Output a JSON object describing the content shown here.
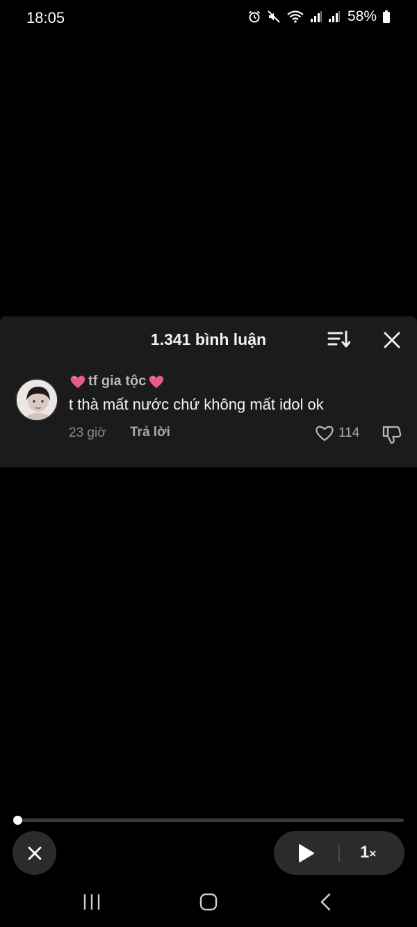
{
  "status_bar": {
    "time": "18:05",
    "battery": "58%",
    "icons": [
      "alarm-icon",
      "mute-icon",
      "wifi-icon",
      "signal-icon",
      "signal-icon",
      "battery-icon"
    ]
  },
  "comments_panel": {
    "title": "1.341 bình luận",
    "sort_icon": "sort-icon",
    "close_icon": "close-icon",
    "comment": {
      "username": "tf gia tộc",
      "username_decoration": "pink-heart-emoji",
      "text": "t thà mất nước chứ không mất idol ok",
      "time": "23 giờ",
      "reply_label": "Trả lời",
      "like_count": "114"
    }
  },
  "player": {
    "progress_fraction": 0.0,
    "speed_value": "1",
    "speed_suffix": "×"
  },
  "colors": {
    "background": "#000000",
    "panel": "#1b1b1d",
    "muted_text": "#8a8a8e",
    "heart": "#e45c8a"
  }
}
